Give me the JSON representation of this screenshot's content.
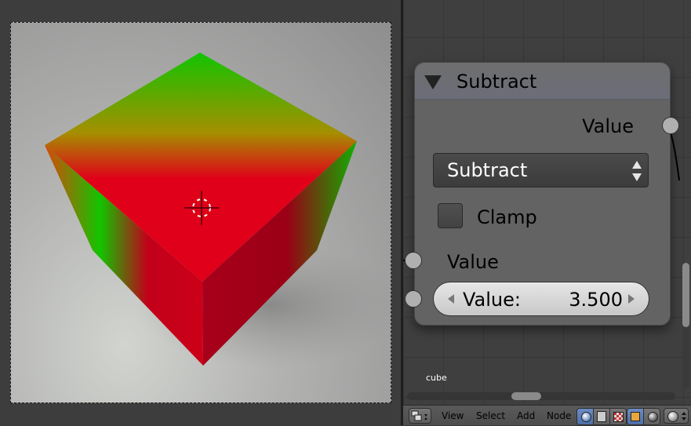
{
  "node": {
    "title": "Subtract",
    "output_label": "Value",
    "operation": "Subtract",
    "clamp_label": "Clamp",
    "clamp_checked": false,
    "input_label": "Value",
    "value_field": {
      "label": "Value:",
      "value": "3.500"
    }
  },
  "node_editor": {
    "frame_label": "cube"
  },
  "header": {
    "menus": {
      "view": "View",
      "select": "Select",
      "add": "Add",
      "node": "Node"
    },
    "editor_type_icon": "node-editor-icon",
    "tree_types": [
      "shader-icon",
      "texture-icon",
      "compositing-icon"
    ],
    "data_types": [
      "object-icon",
      "world-icon"
    ],
    "shading_icon": "material-sphere-icon"
  },
  "viewport": {
    "cursor_icon": "3d-cursor-icon",
    "colors": {
      "red": "#e0001a",
      "green": "#12c400",
      "background": "#a8a9a7"
    }
  }
}
